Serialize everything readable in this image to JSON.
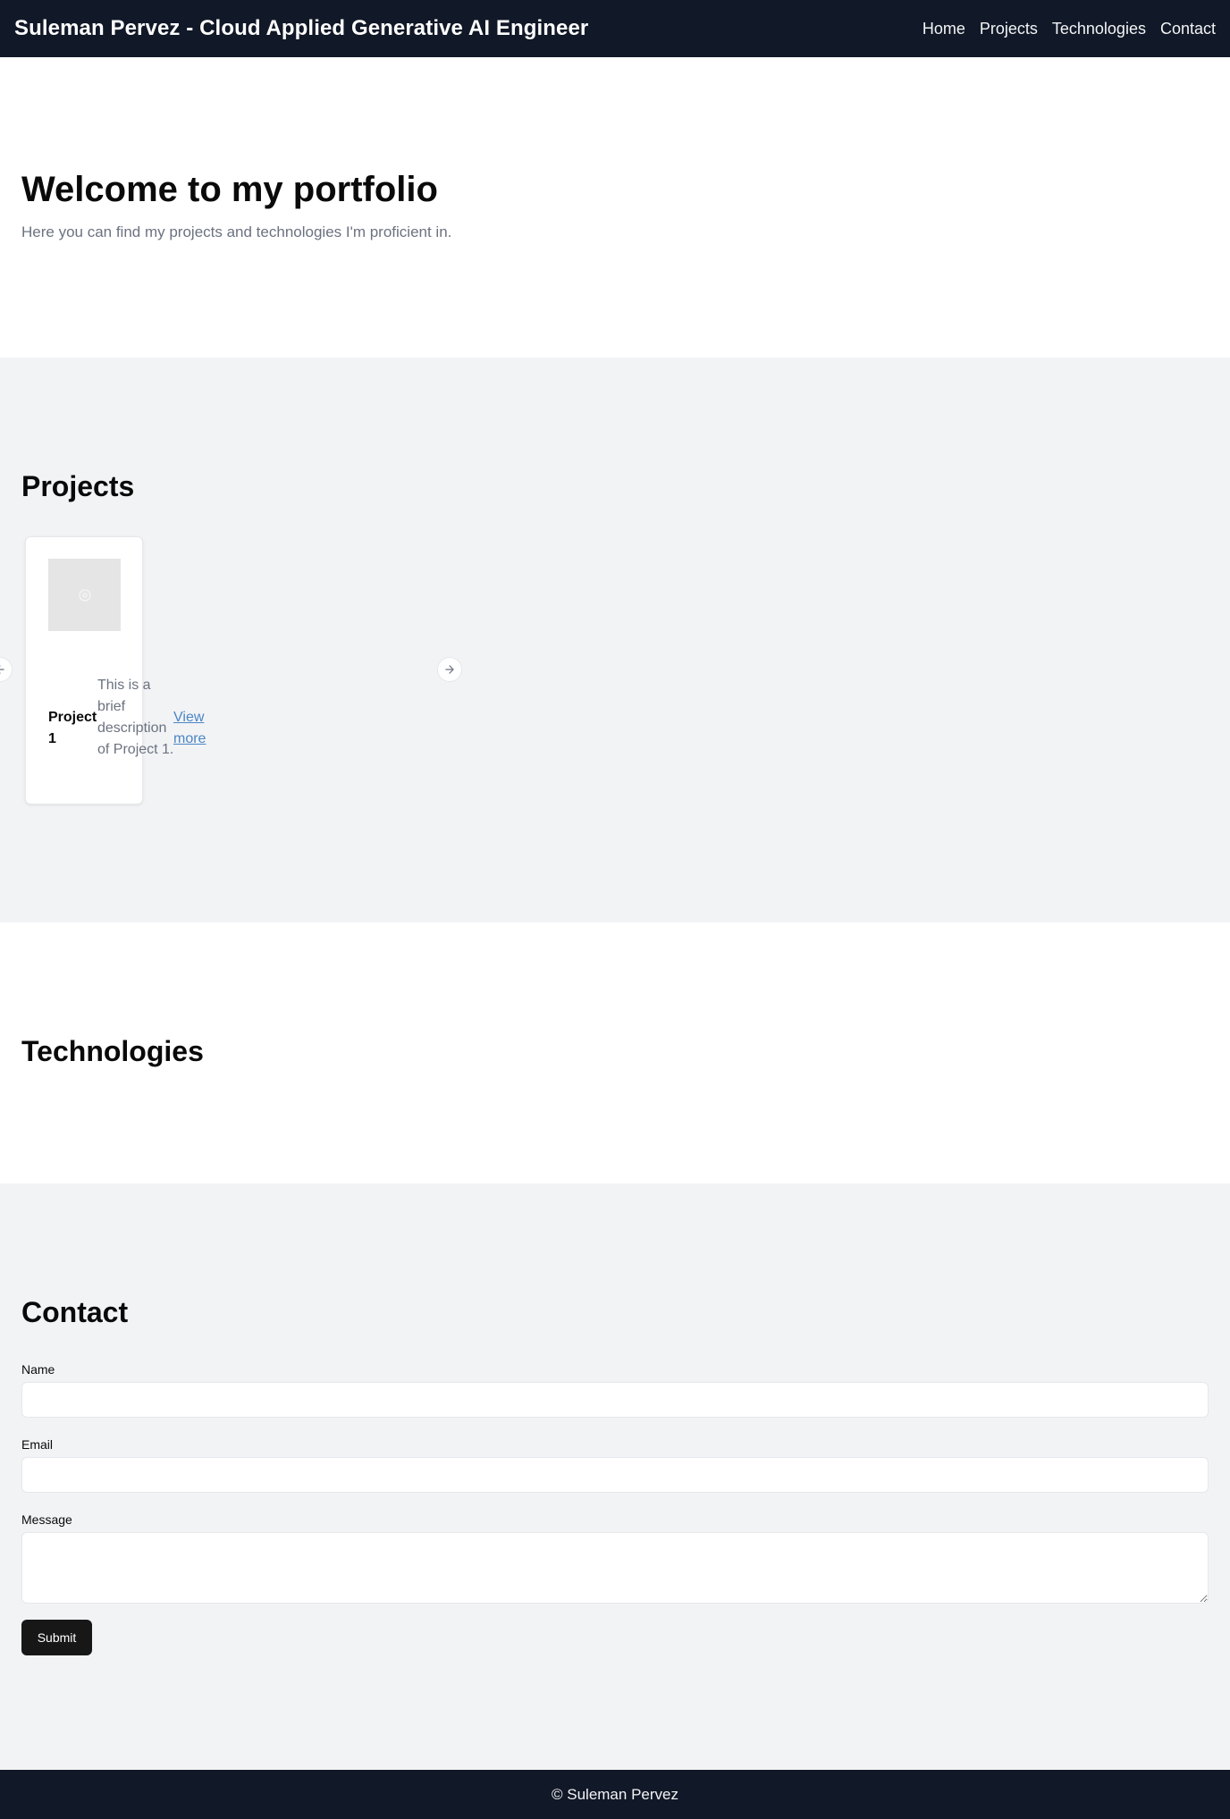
{
  "header": {
    "title": "Suleman Pervez - Cloud Applied Generative AI Engineer",
    "nav": [
      {
        "label": "Home"
      },
      {
        "label": "Projects"
      },
      {
        "label": "Technologies"
      },
      {
        "label": "Contact"
      }
    ]
  },
  "hero": {
    "heading": "Welcome to my portfolio",
    "subtitle": "Here you can find my projects and technologies I'm proficient in."
  },
  "projects": {
    "heading": "Projects",
    "items": [
      {
        "title": "Project 1",
        "description": "This is a brief description of Project 1.",
        "link_label": "View more",
        "image_icon": "image-placeholder-icon"
      }
    ],
    "prev_icon": "arrow-left-icon",
    "next_icon": "arrow-right-icon"
  },
  "technologies": {
    "heading": "Technologies"
  },
  "contact": {
    "heading": "Contact",
    "name_label": "Name",
    "name_value": "",
    "email_label": "Email",
    "email_value": "",
    "message_label": "Message",
    "message_value": "",
    "submit_label": "Submit"
  },
  "footer": {
    "text": "© Suleman Pervez"
  },
  "colors": {
    "header_bg": "#111827",
    "section_alt_bg": "#f2f3f5",
    "link": "#4a86c5",
    "button_bg": "#171717"
  }
}
